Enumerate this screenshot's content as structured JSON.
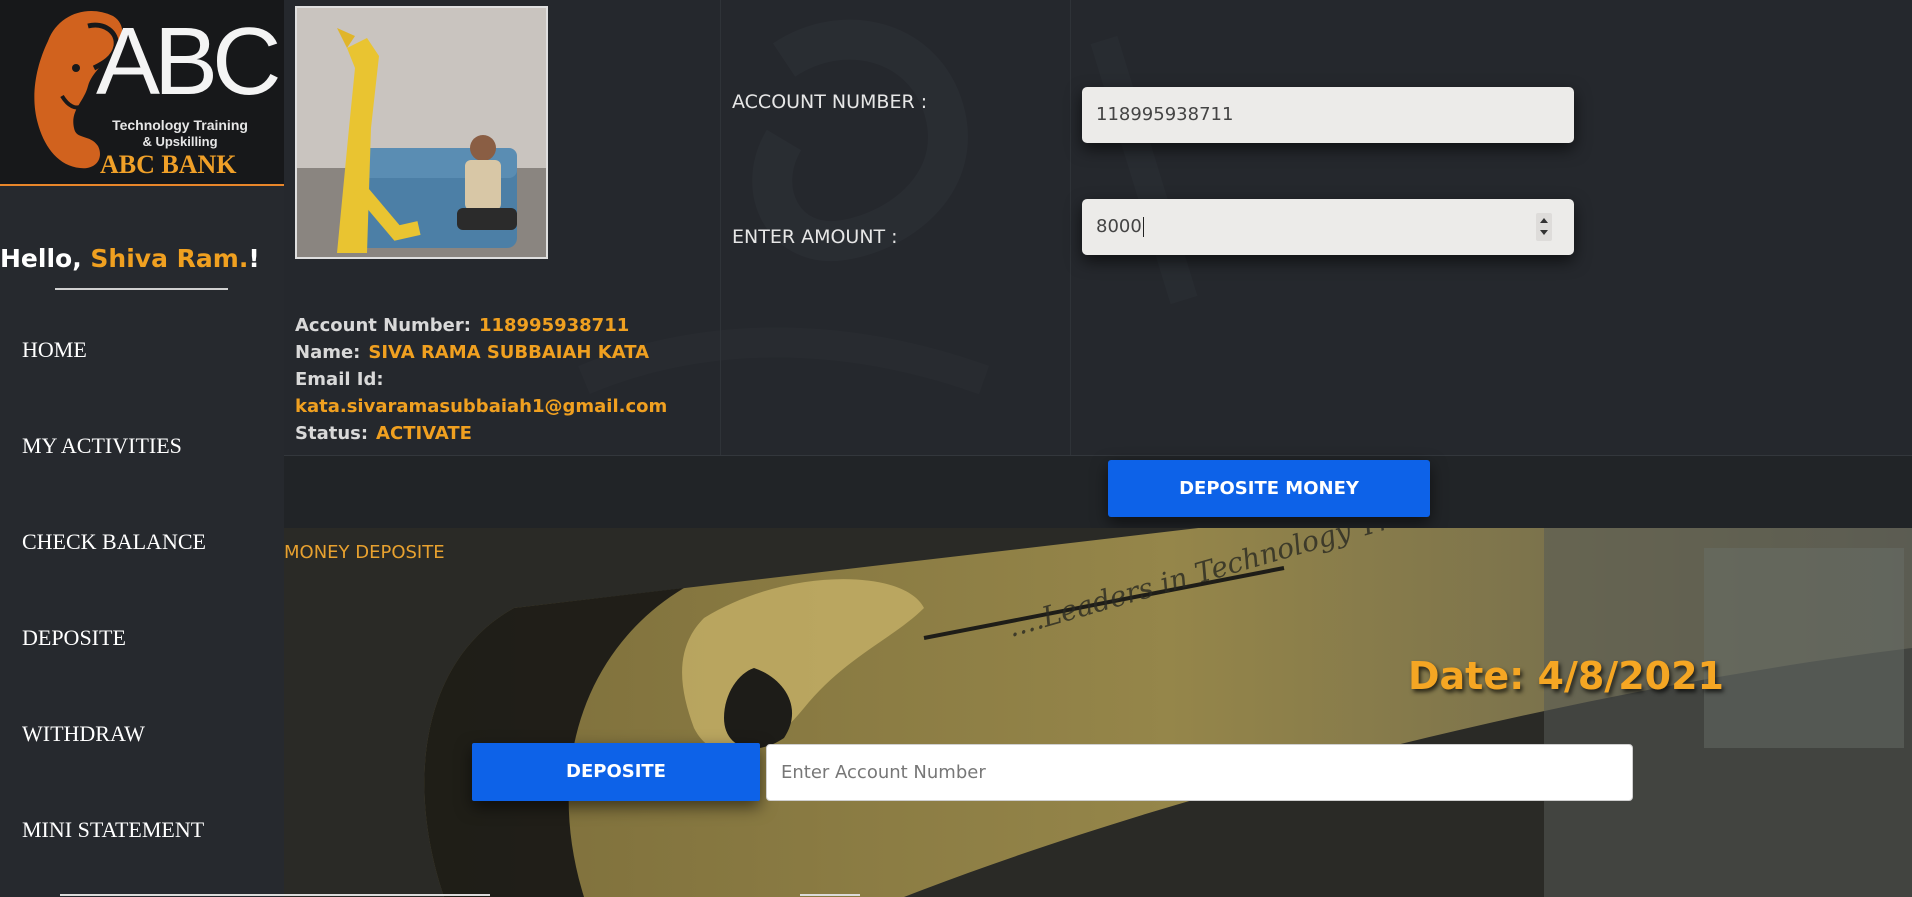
{
  "brand": {
    "logo_text": "ABC",
    "tagline1": "Technology Training",
    "tagline2": "& Upskilling",
    "bank_name": "ABC BANK"
  },
  "greeting": {
    "hello": "Hello, ",
    "user": "Shiva Ram.",
    "suffix": "!"
  },
  "nav": [
    {
      "label": "HOME"
    },
    {
      "label": "MY ACTIVITIES"
    },
    {
      "label": "CHECK BALANCE"
    },
    {
      "label": "DEPOSITE"
    },
    {
      "label": "WITHDRAW"
    },
    {
      "label": "MINI STATEMENT"
    }
  ],
  "profile": {
    "account_label": "Account Number:",
    "account_value": "118995938711",
    "name_label": "Name:",
    "name_value": "SIVA RAMA SUBBAIAH KATA",
    "email_label": "Email Id:",
    "email_value": "kata.sivaramasubbaiah1@gmail.com",
    "status_label": "Status:",
    "status_value": "ACTIVATE"
  },
  "form": {
    "account_label": "ACCOUNT NUMBER :",
    "account_value": "118995938711",
    "amount_label": "ENTER AMOUNT :",
    "amount_value": "8000",
    "submit_label": "DEPOSITE MONEY"
  },
  "hero": {
    "title": "MONEY DEPOSITE",
    "date": "Date: 4/8/2021",
    "button": "DEPOSITE",
    "account_placeholder": "Enter Account Number",
    "wall_text": "....Leaders in Technology Training"
  },
  "colors": {
    "accent": "#f0a020",
    "primary_button": "#0d62e8",
    "sidebar_bg": "#26292e",
    "panel_bg": "#25282d"
  }
}
